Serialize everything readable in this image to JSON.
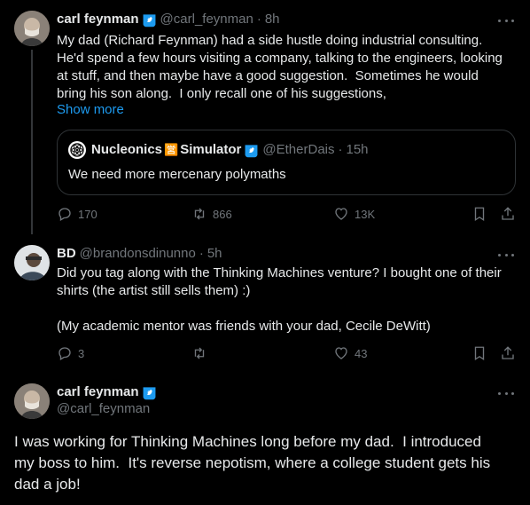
{
  "colors": {
    "background": "#000000",
    "text": "#e7e9ea",
    "secondary": "#71767b",
    "link": "#1d9bf0",
    "verified": "#1d9bf0",
    "border": "#2f3336"
  },
  "tweet1": {
    "name": "carl feynman",
    "handle": "@carl_feynman",
    "separator": "·",
    "time": "8h",
    "text": "My dad (Richard Feynman) had a side hustle doing industrial consulting.\nHe'd spend a few hours visiting a company, talking to the engineers, looking\nat stuff, and then maybe have a good suggestion.  Sometimes he would\nbring his son along.  I only recall one of his suggestions,",
    "show_more": "Show more",
    "quote": {
      "name": "Nucleonics",
      "emoji": "🈺",
      "name_suffix": "Simulator",
      "handle": "@EtherDais",
      "separator": "·",
      "time": "15h",
      "text": "We need more mercenary polymaths"
    },
    "replies": "170",
    "retweets": "866",
    "likes": "13K"
  },
  "tweet2": {
    "name": "BD",
    "handle": "@brandonsdinunno",
    "separator": "·",
    "time": "5h",
    "text": "Did you tag along with the Thinking Machines venture? I bought one of their\nshirts (the artist still sells them) :)\n\n(My academic mentor was friends with your dad, Cecile DeWitt)",
    "replies": "3",
    "retweets": "",
    "likes": "43"
  },
  "tweet3": {
    "name": "carl feynman",
    "handle": "@carl_feynman",
    "text": "I was working for Thinking Machines long before my dad.  I introduced\nmy boss to him.  It's reverse nepotism, where a college student gets his\ndad a job!"
  },
  "icons": {
    "verified": "verified-badge-icon",
    "more": "more-dots-icon",
    "reply": "reply-icon",
    "retweet": "retweet-icon",
    "like": "heart-icon",
    "bookmark": "bookmark-icon",
    "share": "share-icon"
  }
}
